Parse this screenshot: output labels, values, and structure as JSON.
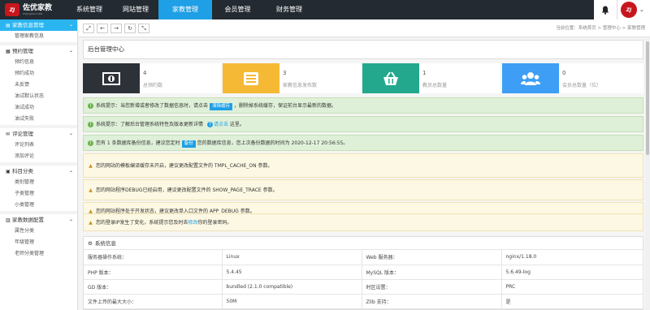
{
  "brand": {
    "logo_mark": "ZJ",
    "name": "佐优家教",
    "sub": "ZYJIAJIAO.COM",
    "accent": "#1e9fe6"
  },
  "topnav": [
    {
      "label": "系统管理"
    },
    {
      "label": "网站管理"
    },
    {
      "label": "家教管理",
      "active": true
    },
    {
      "label": "会员管理"
    },
    {
      "label": "财务管理"
    }
  ],
  "sidebar": {
    "groups": [
      {
        "label": "家教信息管理",
        "icon": "list-icon",
        "active": true,
        "items": [
          "管理家教信息"
        ]
      },
      {
        "label": "预约管理",
        "icon": "calendar-icon",
        "items": [
          "预约信息",
          "预约成功",
          "未反馈",
          "油试默认状态",
          "油试成功",
          "油试失败"
        ]
      },
      {
        "label": "评论管理",
        "icon": "comment-icon",
        "items": [
          "评论列表",
          "添加评论"
        ]
      },
      {
        "label": "科目分类",
        "icon": "folder-icon",
        "items": [
          "类别管理",
          "子类管理",
          "小类管理"
        ]
      },
      {
        "label": "家教数据配置",
        "icon": "database-icon",
        "items": [
          "属性分类",
          "年级管理",
          "老师分类管理"
        ]
      }
    ]
  },
  "tabbar": {
    "breadcrumb": "当前位置：系统首页 > 管理中心 > 家教管理"
  },
  "main": {
    "title": "后台管理中心",
    "stats": [
      {
        "num": "4",
        "label": "总预约数",
        "color": "#2d3138",
        "icon": "money-icon"
      },
      {
        "num": "3",
        "label": "家教信息发布数",
        "color": "#f6b936",
        "icon": "file-icon"
      },
      {
        "num": "1",
        "label": "教员总数量",
        "color": "#23a88e",
        "icon": "basket-icon"
      },
      {
        "num": "0",
        "label": "会员总数量（位）",
        "color": "#3e9ef5",
        "icon": "users-icon"
      }
    ],
    "alerts": {
      "a1": {
        "pre": "系统提示：当您新增或者修改了数据信息时，请点击",
        "btn": "清除缓存",
        "post": "，删除掉系统缓存，保证前台显示最新的数据。"
      },
      "a2": {
        "pre": "系统提示：了解后台管理系统特性及版本更新详情",
        "link": "请点击",
        "post": "这里。"
      },
      "a3": {
        "pre": "您有 1 条数据库备份信息，建议您定时",
        "btn": "备份",
        "post": "您的数据库信息，您上次备份数据的时间为 2020-12-17 20:56:55。"
      },
      "a4": "您的网站的模板编译缓存未开启，建议更改配置文件的 TMPL_CACHE_ON 参数。",
      "a5": "您的网站程序DEBUG已经启用，建议更改配置文件的 SHOW_PAGE_TRACE 参数。",
      "a6": "您的网站程序处于开发状态，建议更改单入口文件的 APP_DEBUG 参数。",
      "a7": {
        "pre": "您的登录IP发生了变化，系统提示您及时去",
        "link": "修改",
        "post": "你的登录密码。"
      }
    },
    "sysinfo": {
      "title": "系统信息",
      "rows": [
        [
          "服务器操作系统：",
          "Linux",
          "Web 服务器：",
          "nginx/1.18.0"
        ],
        [
          "PHP 版本：",
          "5.4.45",
          "MySQL 版本：",
          "5.6.49-log"
        ],
        [
          "GD 版本：",
          "bundled (2.1.0 compatible)",
          "时区设置：",
          "PRC"
        ],
        [
          "文件上传的最大大小：",
          "50M",
          "Zlib 支持：",
          "是"
        ]
      ]
    }
  }
}
